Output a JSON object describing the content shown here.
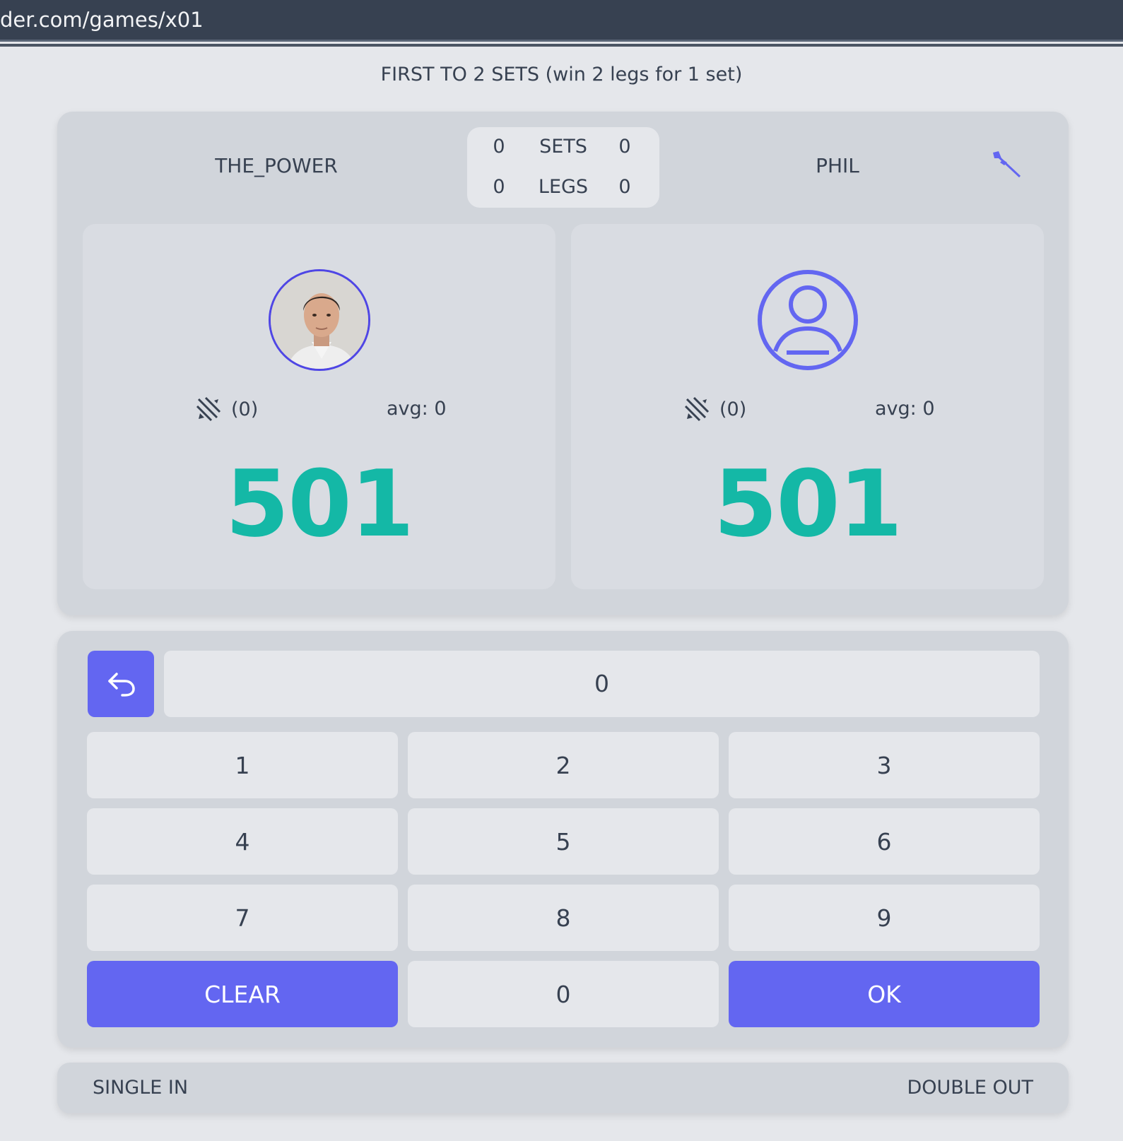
{
  "browser": {
    "url": "der.com/games/x01"
  },
  "match": {
    "title": "FIRST TO 2 SETS (win 2 legs for 1 set)"
  },
  "scoreboard": {
    "player1_name": "THE_POWER",
    "player2_name": "PHIL",
    "sets_label": "SETS",
    "legs_label": "LEGS",
    "player1_sets": "0",
    "player2_sets": "0",
    "player1_legs": "0",
    "player2_legs": "0",
    "active_player_icon": "dart-icon"
  },
  "players": [
    {
      "darts": "(0)",
      "avg": "avg: 0",
      "remaining": "501",
      "avatar": "photo"
    },
    {
      "darts": "(0)",
      "avg": "avg: 0",
      "remaining": "501",
      "avatar": "user-circle-icon"
    }
  ],
  "keypad": {
    "input_value": "0",
    "undo_icon": "undo-icon",
    "keys": [
      "1",
      "2",
      "3",
      "4",
      "5",
      "6",
      "7",
      "8",
      "9"
    ],
    "clear_label": "CLEAR",
    "zero_label": "0",
    "ok_label": "OK"
  },
  "mode": {
    "in": "SINGLE IN",
    "out": "DOUBLE OUT"
  },
  "colors": {
    "accent": "#6366f1",
    "score": "#14b8a6",
    "panel": "#d1d5db",
    "background": "#e5e7eb"
  }
}
